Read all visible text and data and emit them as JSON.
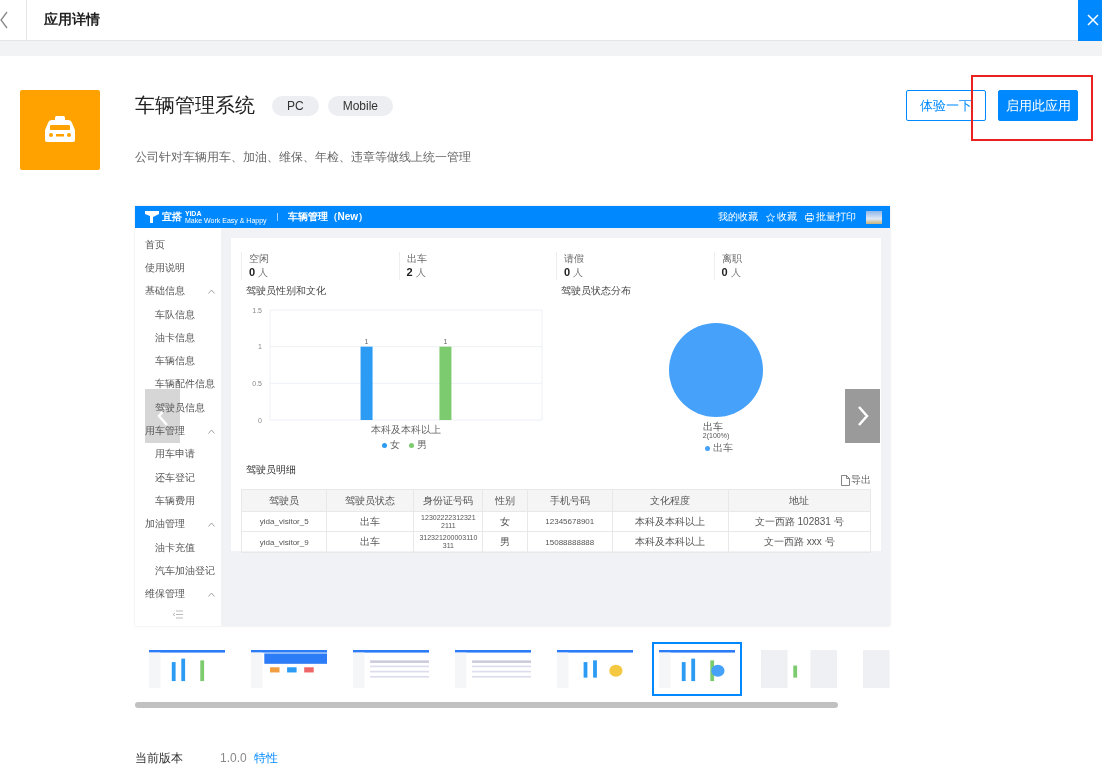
{
  "header": {
    "title": "应用详情"
  },
  "app": {
    "name": "车辆管理系统",
    "platforms": [
      "PC",
      "Mobile"
    ],
    "description": "公司针对车辆用车、加油、维保、年检、违章等做线上统一管理",
    "actions": [
      {
        "label": "体验一下",
        "kind": "secondary",
        "highlighted": false
      },
      {
        "label": "启用此应用",
        "kind": "primary",
        "highlighted": true
      }
    ]
  },
  "preview": {
    "topbar": {
      "brand": "宜搭",
      "brand_latin": "YiDA",
      "tagline": "Make Work Easy & Happy",
      "app_title": "车辆管理（New）",
      "links": [
        {
          "label": "我的收藏",
          "kind": "plain"
        },
        {
          "label": "收藏",
          "kind": "favorite"
        },
        {
          "label": "批量打印",
          "kind": "print"
        }
      ]
    },
    "sidebar": [
      {
        "label": "首页"
      },
      {
        "label": "使用说明"
      },
      {
        "label": "基础信息",
        "expanded": true,
        "children": [
          {
            "label": "车队信息"
          },
          {
            "label": "油卡信息"
          },
          {
            "label": "车辆信息"
          },
          {
            "label": "车辆配件信息"
          },
          {
            "label": "驾驶员信息"
          }
        ]
      },
      {
        "label": "用车管理",
        "expanded": true,
        "children": [
          {
            "label": "用车申请"
          },
          {
            "label": "还车登记"
          },
          {
            "label": "车辆费用"
          }
        ]
      },
      {
        "label": "加油管理",
        "expanded": true,
        "children": [
          {
            "label": "油卡充值"
          },
          {
            "label": "汽车加油登记"
          }
        ]
      },
      {
        "label": "维保管理",
        "expanded": true
      }
    ],
    "stats": [
      {
        "label": "空闲",
        "value": "0",
        "unit": "人"
      },
      {
        "label": "出车",
        "value": "2",
        "unit": "人"
      },
      {
        "label": "请假",
        "value": "0",
        "unit": "人"
      },
      {
        "label": "离职",
        "value": "0",
        "unit": "人"
      }
    ],
    "bar_chart": {
      "chart_data": {
        "type": "bar",
        "title": "驾驶员性别和文化",
        "categories": [
          "本科及本科以上"
        ],
        "ylim": [
          0,
          1.5
        ],
        "yticks": [
          0,
          0.5,
          1,
          1.5
        ],
        "data_labels": true,
        "legend": "bottom",
        "series": [
          {
            "name": "女",
            "color": "#2b9bf4",
            "values": [
              1
            ]
          },
          {
            "name": "男",
            "color": "#7ccb6e",
            "values": [
              1
            ]
          }
        ]
      }
    },
    "pie_chart": {
      "chart_data": {
        "type": "pie",
        "title": "驾驶员状态分布",
        "categories": [
          "出车"
        ],
        "value_labels": [
          "2(100%)"
        ],
        "legend": "bottom",
        "series": [
          {
            "name": "出车",
            "color": "#45a1f9",
            "values": [
              100
            ]
          }
        ]
      }
    },
    "detail": {
      "title": "驾驶员明细",
      "export": "导出",
      "columns": [
        "驾驶员",
        "驾驶员状态",
        "身份证号码",
        "性别",
        "手机号码",
        "文化程度",
        "地址"
      ],
      "rows": [
        [
          "yida_visitor_5",
          "出车",
          "123022223123212111",
          "女",
          "12345678901",
          "本科及本科以上",
          "文一西路 102831 号"
        ],
        [
          "yida_visitor_9",
          "出车",
          "312321200003110311",
          "男",
          "15088888888",
          "本科及本科以上",
          "文一西路 xxx 号"
        ]
      ]
    }
  },
  "thumbnails": [
    {
      "kind": "bars",
      "selected": false
    },
    {
      "kind": "portal",
      "selected": false
    },
    {
      "kind": "table",
      "selected": false
    },
    {
      "kind": "table",
      "selected": false
    },
    {
      "kind": "pie",
      "selected": false
    },
    {
      "kind": "bars",
      "selected": true
    },
    {
      "kind": "mobile",
      "selected": false
    },
    {
      "kind": "mobile",
      "selected": false
    }
  ],
  "version": {
    "label": "当前版本",
    "value": "1.0.0",
    "link": "特性"
  }
}
